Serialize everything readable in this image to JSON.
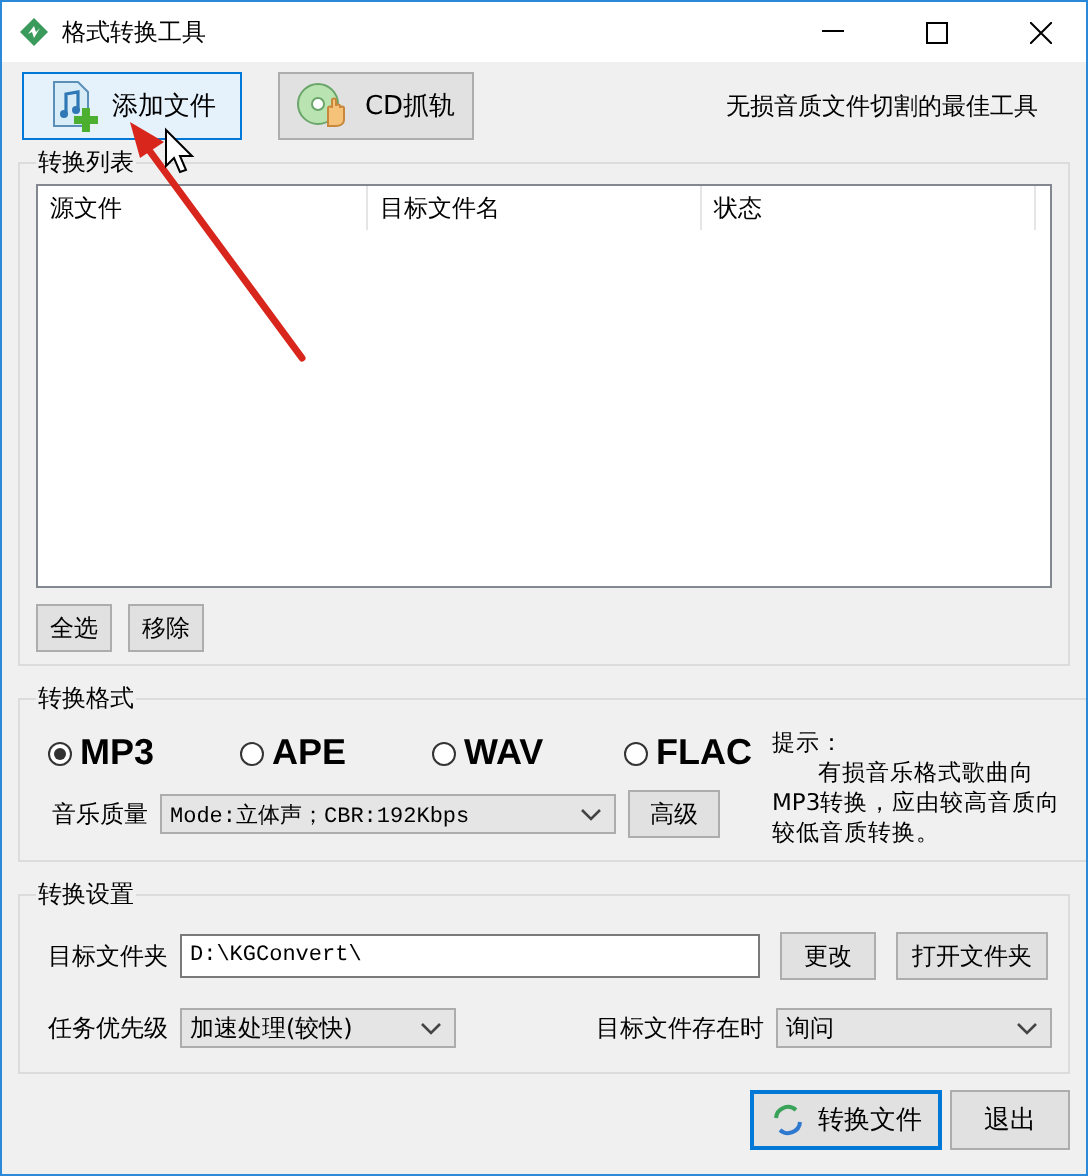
{
  "window": {
    "title": "格式转换工具"
  },
  "toolbar": {
    "buttons": [
      {
        "label": "添加文件",
        "kind": "add",
        "selected": true
      },
      {
        "label": "CD抓轨",
        "kind": "cd",
        "selected": false
      }
    ],
    "tagline": "无损音质文件切割的最佳工具"
  },
  "conversion_list": {
    "title": "转换列表",
    "columns": [
      "源文件",
      "目标文件名",
      "状态"
    ],
    "buttons": [
      "全选",
      "移除"
    ]
  },
  "format": {
    "title": "转换格式",
    "options": [
      {
        "label": "MP3",
        "selected": true
      },
      {
        "label": "APE",
        "selected": false
      },
      {
        "label": "WAV",
        "selected": false
      },
      {
        "label": "FLAC",
        "selected": false
      }
    ],
    "quality_label": "音乐质量",
    "quality_value": "Mode:立体声；CBR:192Kbps",
    "advanced_button": "高级",
    "hint_title": "提示：",
    "hint_text": "有损音乐格式歌曲向MP3转换，应由较高音质向较低音质转换。"
  },
  "settings": {
    "title": "转换设置",
    "folder_label": "目标文件夹",
    "folder_value": "D:\\KGConvert\\",
    "change_button": "更改",
    "open_button": "打开文件夹",
    "priority_label": "任务优先级",
    "priority_value": "加速处理(较快)",
    "exists_label": "目标文件存在时",
    "exists_value": "询问"
  },
  "footer": {
    "convert_button": "转换文件",
    "exit_button": "退出"
  }
}
